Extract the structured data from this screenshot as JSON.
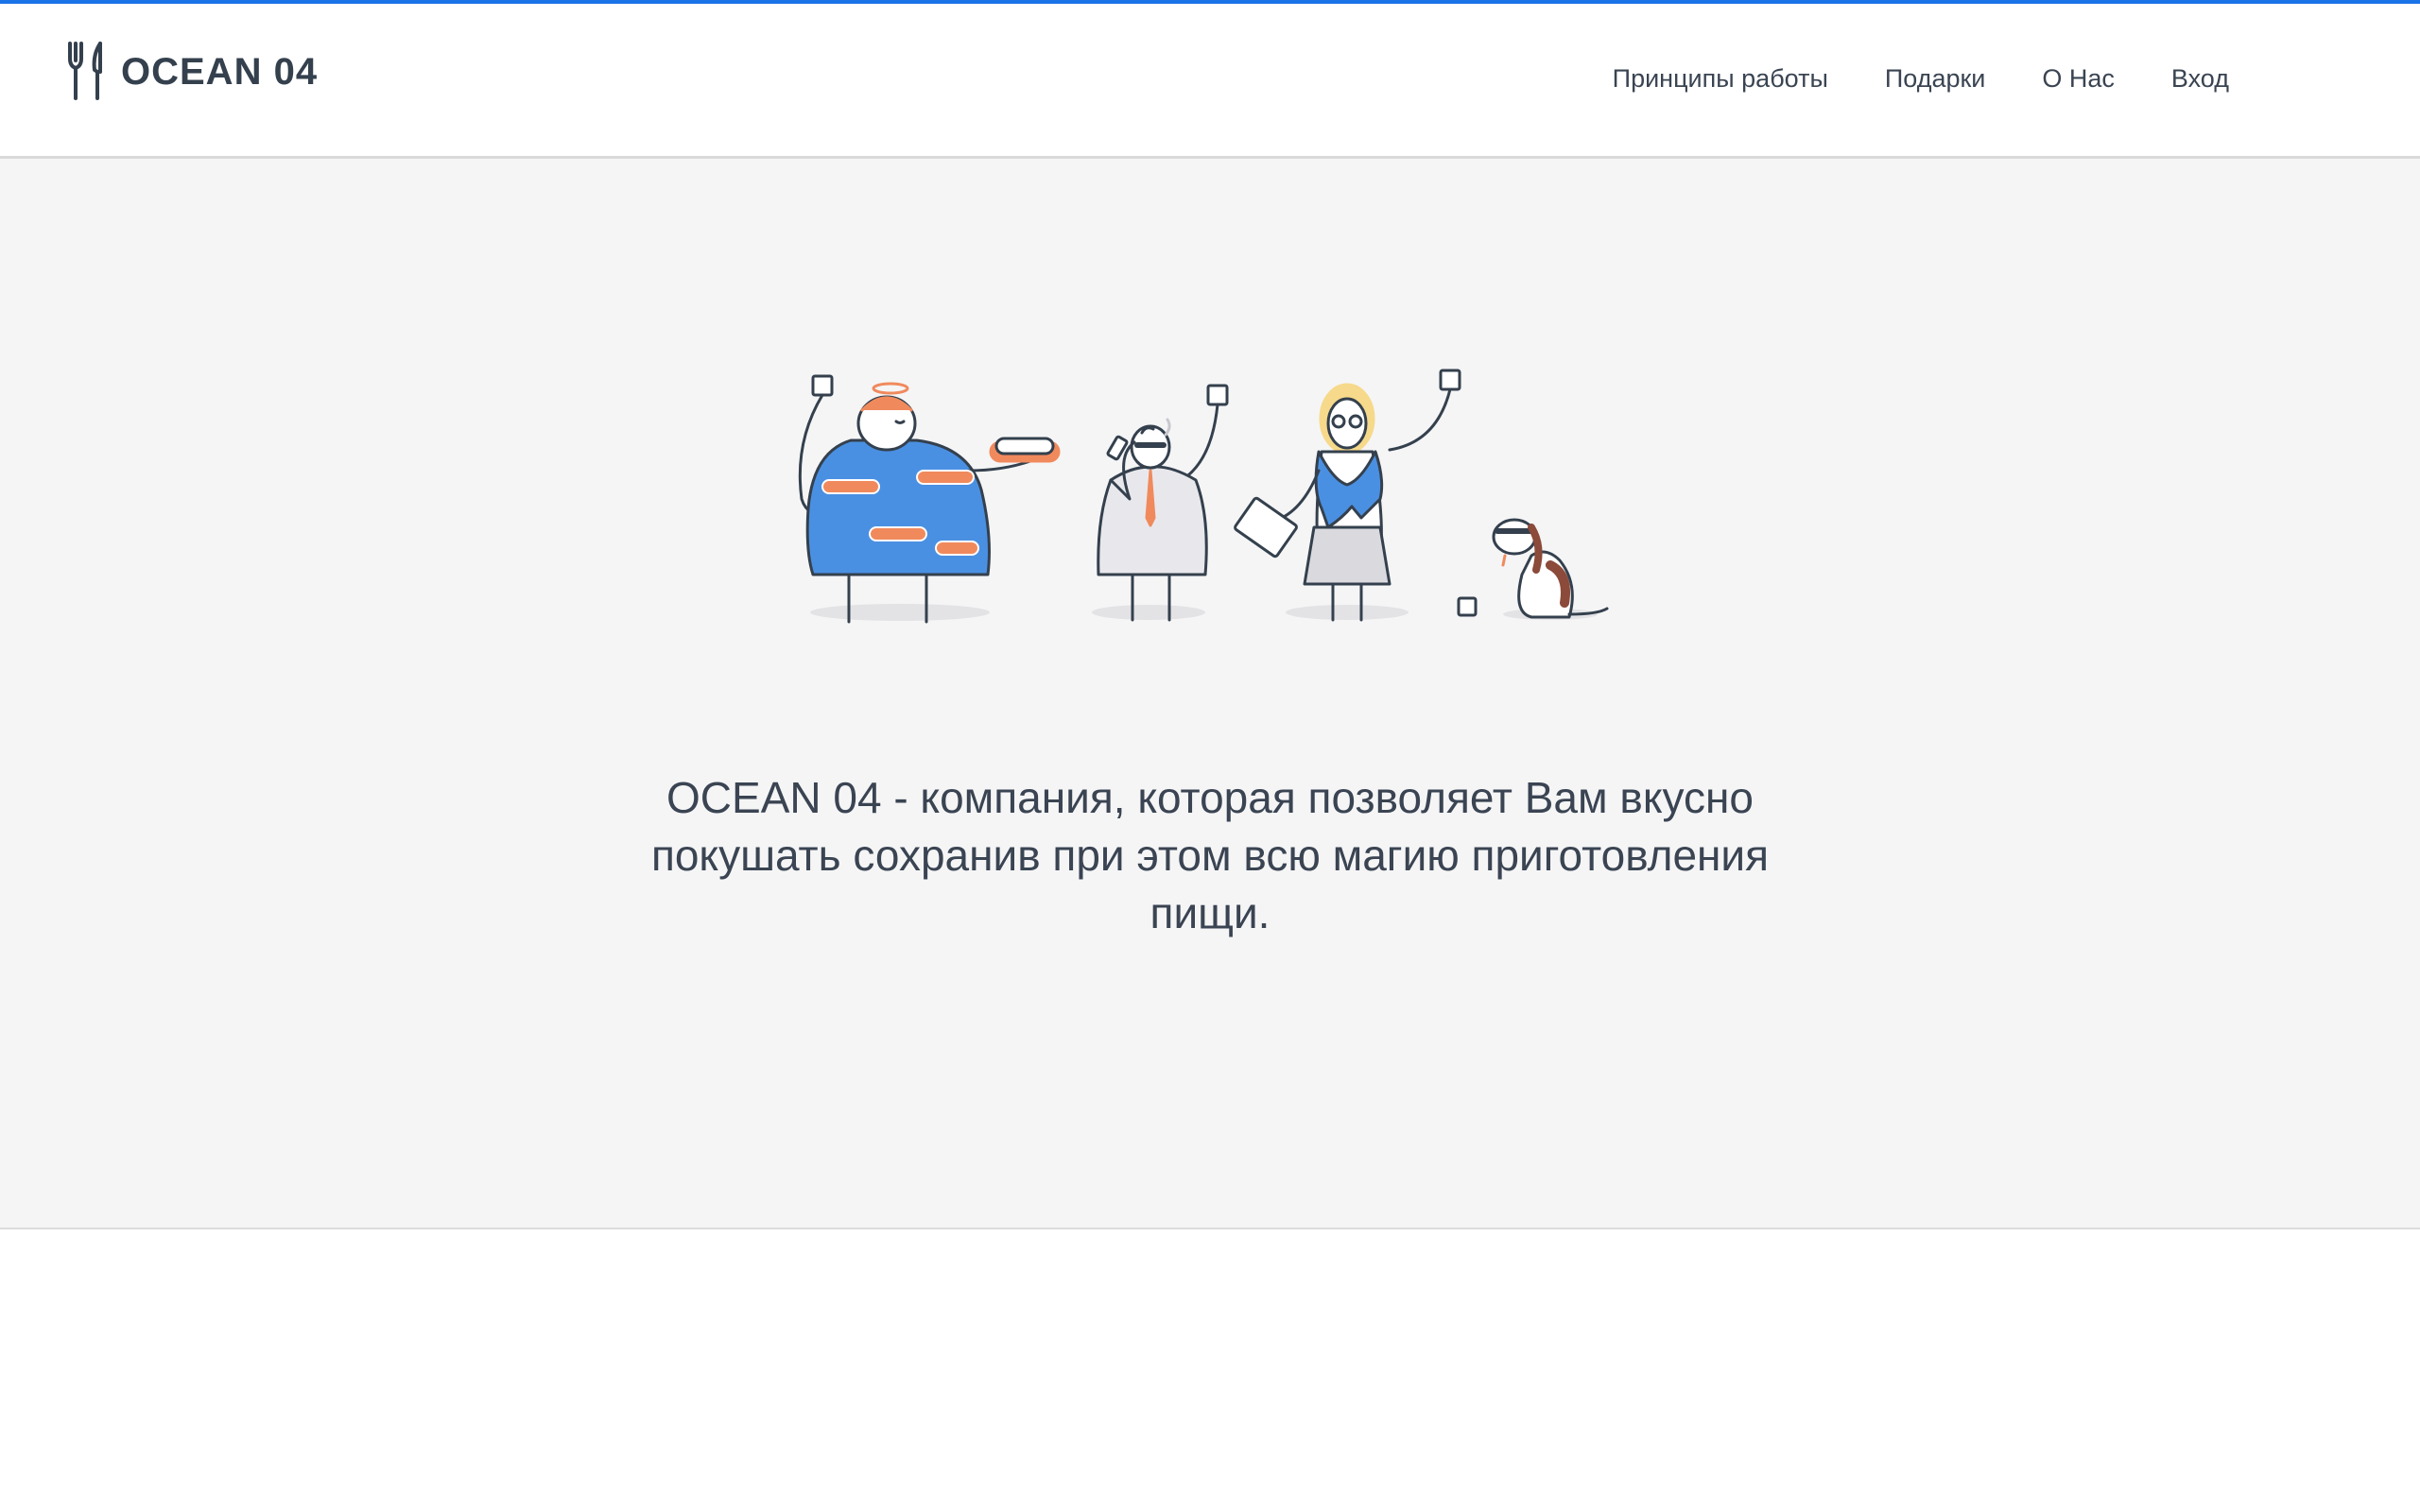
{
  "header": {
    "brand": "OCEAN 04",
    "logo_icon": "fork-knife-icon",
    "nav": [
      {
        "label": "Принципы работы"
      },
      {
        "label": "Подарки"
      },
      {
        "label": "О Нас"
      },
      {
        "label": "Вход"
      }
    ]
  },
  "hero": {
    "illustration": "people-and-dog-illustration",
    "tagline": "OCEAN 04 - компания, которая позволяет Вам вкусно покушать сохранив при этом всю магию приготовления пищи."
  },
  "colors": {
    "accent": "#1a73e8",
    "text": "#3a4452",
    "hero_bg": "#f5f5f6",
    "illustration_blue": "#4a90e2",
    "illustration_orange": "#f08a5d"
  }
}
